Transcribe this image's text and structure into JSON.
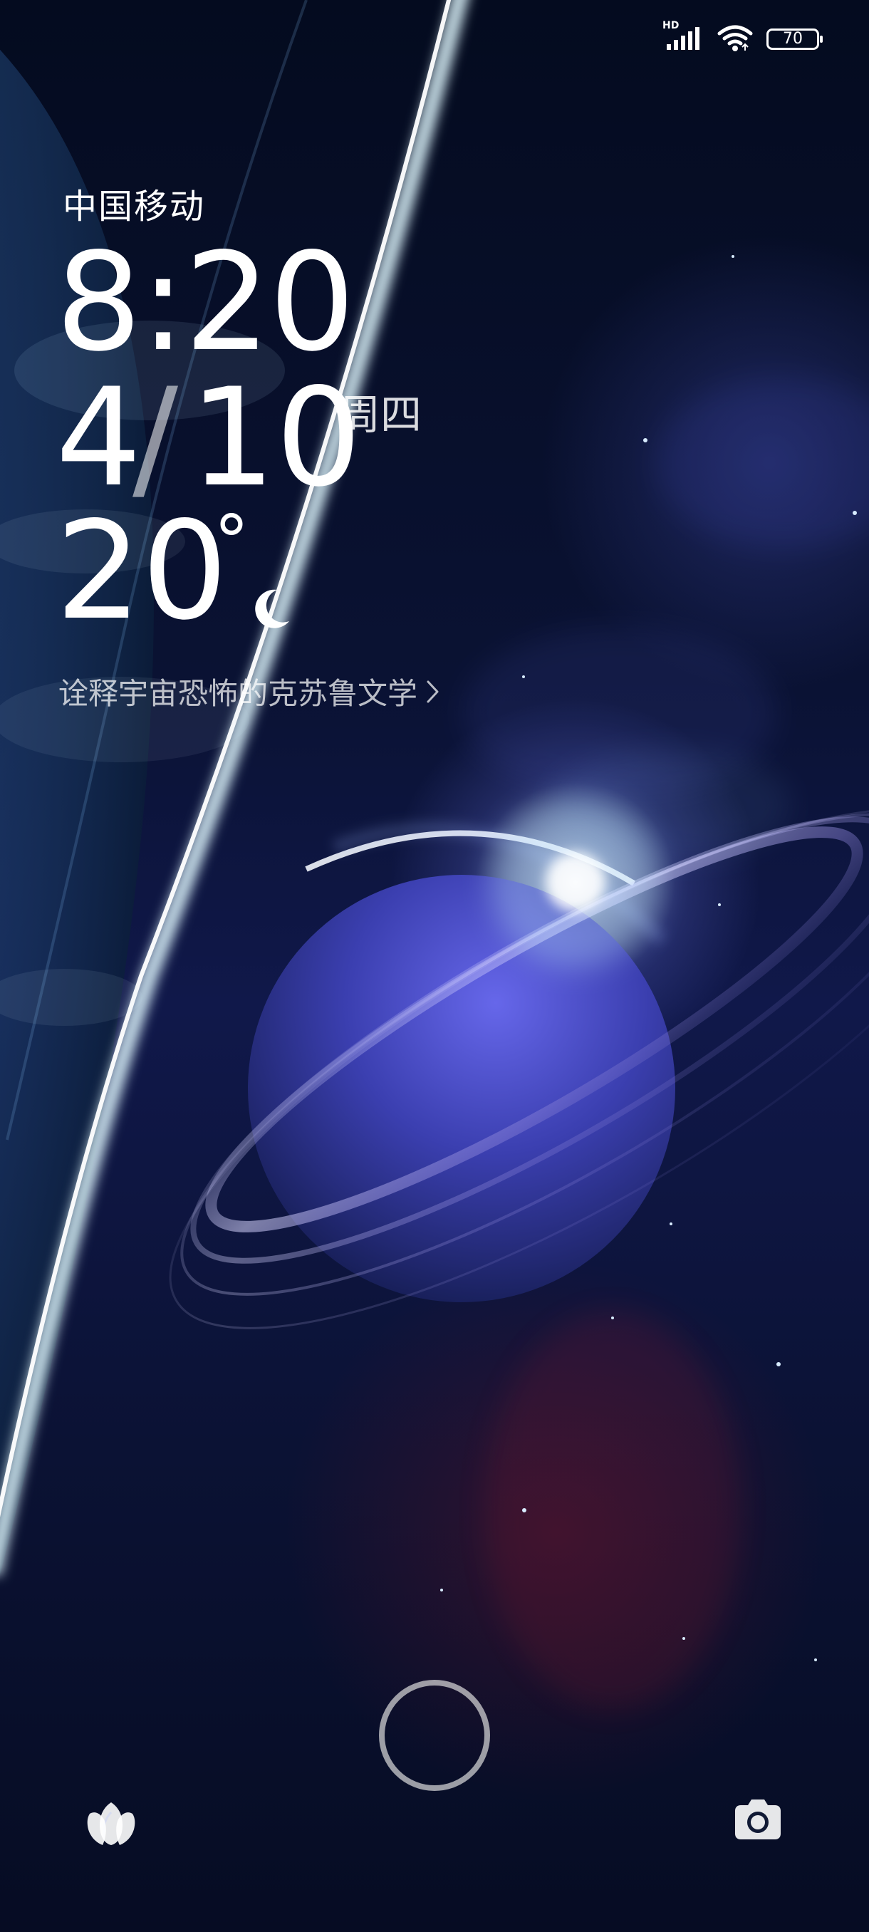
{
  "status_bar": {
    "network_label": "HD",
    "battery_percent": "70"
  },
  "lock_screen": {
    "carrier": "中国移动",
    "time": "8:20",
    "date_month": "4",
    "date_slash": "/",
    "date_day": "10",
    "weekday": "周四",
    "temperature_value": "20",
    "temperature_unit": "°",
    "weather_icon": "crescent-moon-icon",
    "headline": "诠释宇宙恐怖的克苏鲁文学"
  },
  "bottom_bar": {
    "left_icon": "tulip-icon",
    "unlock_control": "unlock-ring",
    "right_icon": "camera-icon"
  },
  "colors": {
    "text_primary": "#ffffff",
    "text_muted": "#d9ddf0",
    "wallpaper_accent": "#4b56d6",
    "wallpaper_glow": "#bfe7ff"
  }
}
